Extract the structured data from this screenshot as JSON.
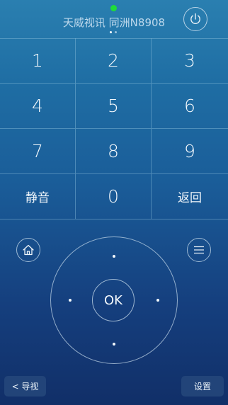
{
  "header": {
    "device_title": "天威视讯 同洲N8908",
    "connection_color": "#1fdc3a",
    "power_icon": "power-icon"
  },
  "keypad": {
    "keys": [
      "1",
      "2",
      "3",
      "4",
      "5",
      "6",
      "7",
      "8",
      "9",
      "静音",
      "0",
      "返回"
    ]
  },
  "navigation": {
    "home_icon": "home-icon",
    "menu_icon": "menu-icon",
    "ok_label": "OK"
  },
  "bottom_bar": {
    "guide_label": "< 导视",
    "settings_label": "设置"
  }
}
